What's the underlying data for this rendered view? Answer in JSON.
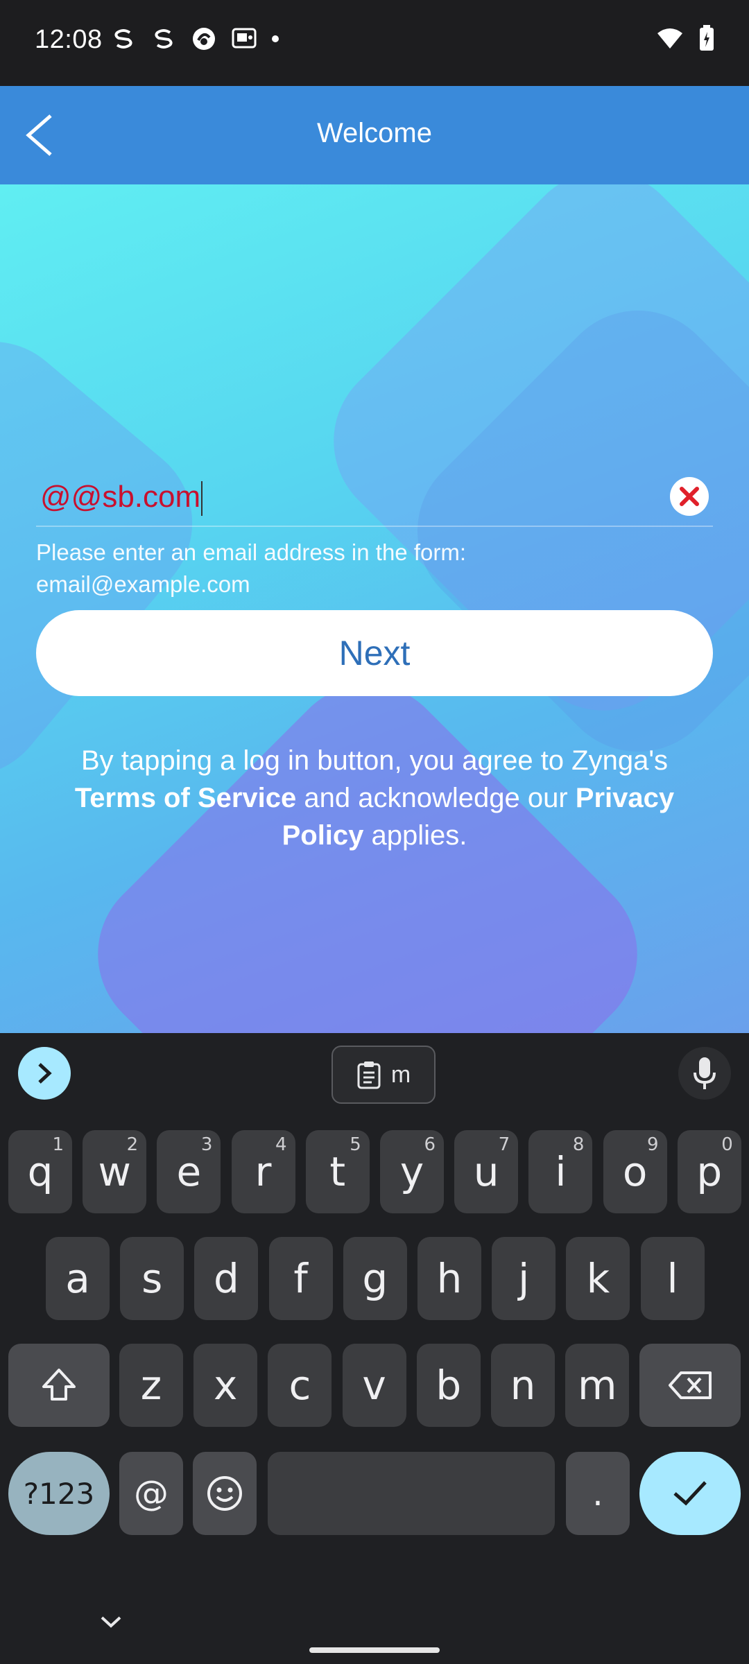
{
  "status_bar": {
    "time": "12:08",
    "left_icons": [
      "s-sync-icon",
      "s-sync-icon",
      "app-circle-icon",
      "screen-icon"
    ],
    "right_icons": [
      "wifi-icon",
      "battery-icon"
    ]
  },
  "header": {
    "title": "Welcome"
  },
  "form": {
    "email_value": "@@sb.com",
    "email_placeholder": "",
    "error_line1": "Please enter an email address in the form:",
    "error_line2": "email@example.com",
    "next_label": "Next"
  },
  "legal": {
    "part1": "By tapping a log in button, you agree to Zynga's",
    "terms": "Terms of Service",
    "part2": "and acknowledge our",
    "privacy1": "Privacy",
    "privacy2": "Policy",
    "part3": "applies."
  },
  "keyboard": {
    "clipboard_text": "m",
    "row1": [
      {
        "k": "q",
        "n": "1"
      },
      {
        "k": "w",
        "n": "2"
      },
      {
        "k": "e",
        "n": "3"
      },
      {
        "k": "r",
        "n": "4"
      },
      {
        "k": "t",
        "n": "5"
      },
      {
        "k": "y",
        "n": "6"
      },
      {
        "k": "u",
        "n": "7"
      },
      {
        "k": "i",
        "n": "8"
      },
      {
        "k": "o",
        "n": "9"
      },
      {
        "k": "p",
        "n": "0"
      }
    ],
    "row2": [
      "a",
      "s",
      "d",
      "f",
      "g",
      "h",
      "j",
      "k",
      "l"
    ],
    "row3": [
      "z",
      "x",
      "c",
      "v",
      "b",
      "n",
      "m"
    ],
    "sym_label": "?123",
    "at_label": "@",
    "period_label": "."
  },
  "colors": {
    "header": "#3a8ada",
    "error_text": "#c8102e",
    "next_text": "#2e6fb8",
    "keyboard_bg": "#1f2023",
    "key_bg": "#3c3d40",
    "accent": "#a7e9ff"
  }
}
